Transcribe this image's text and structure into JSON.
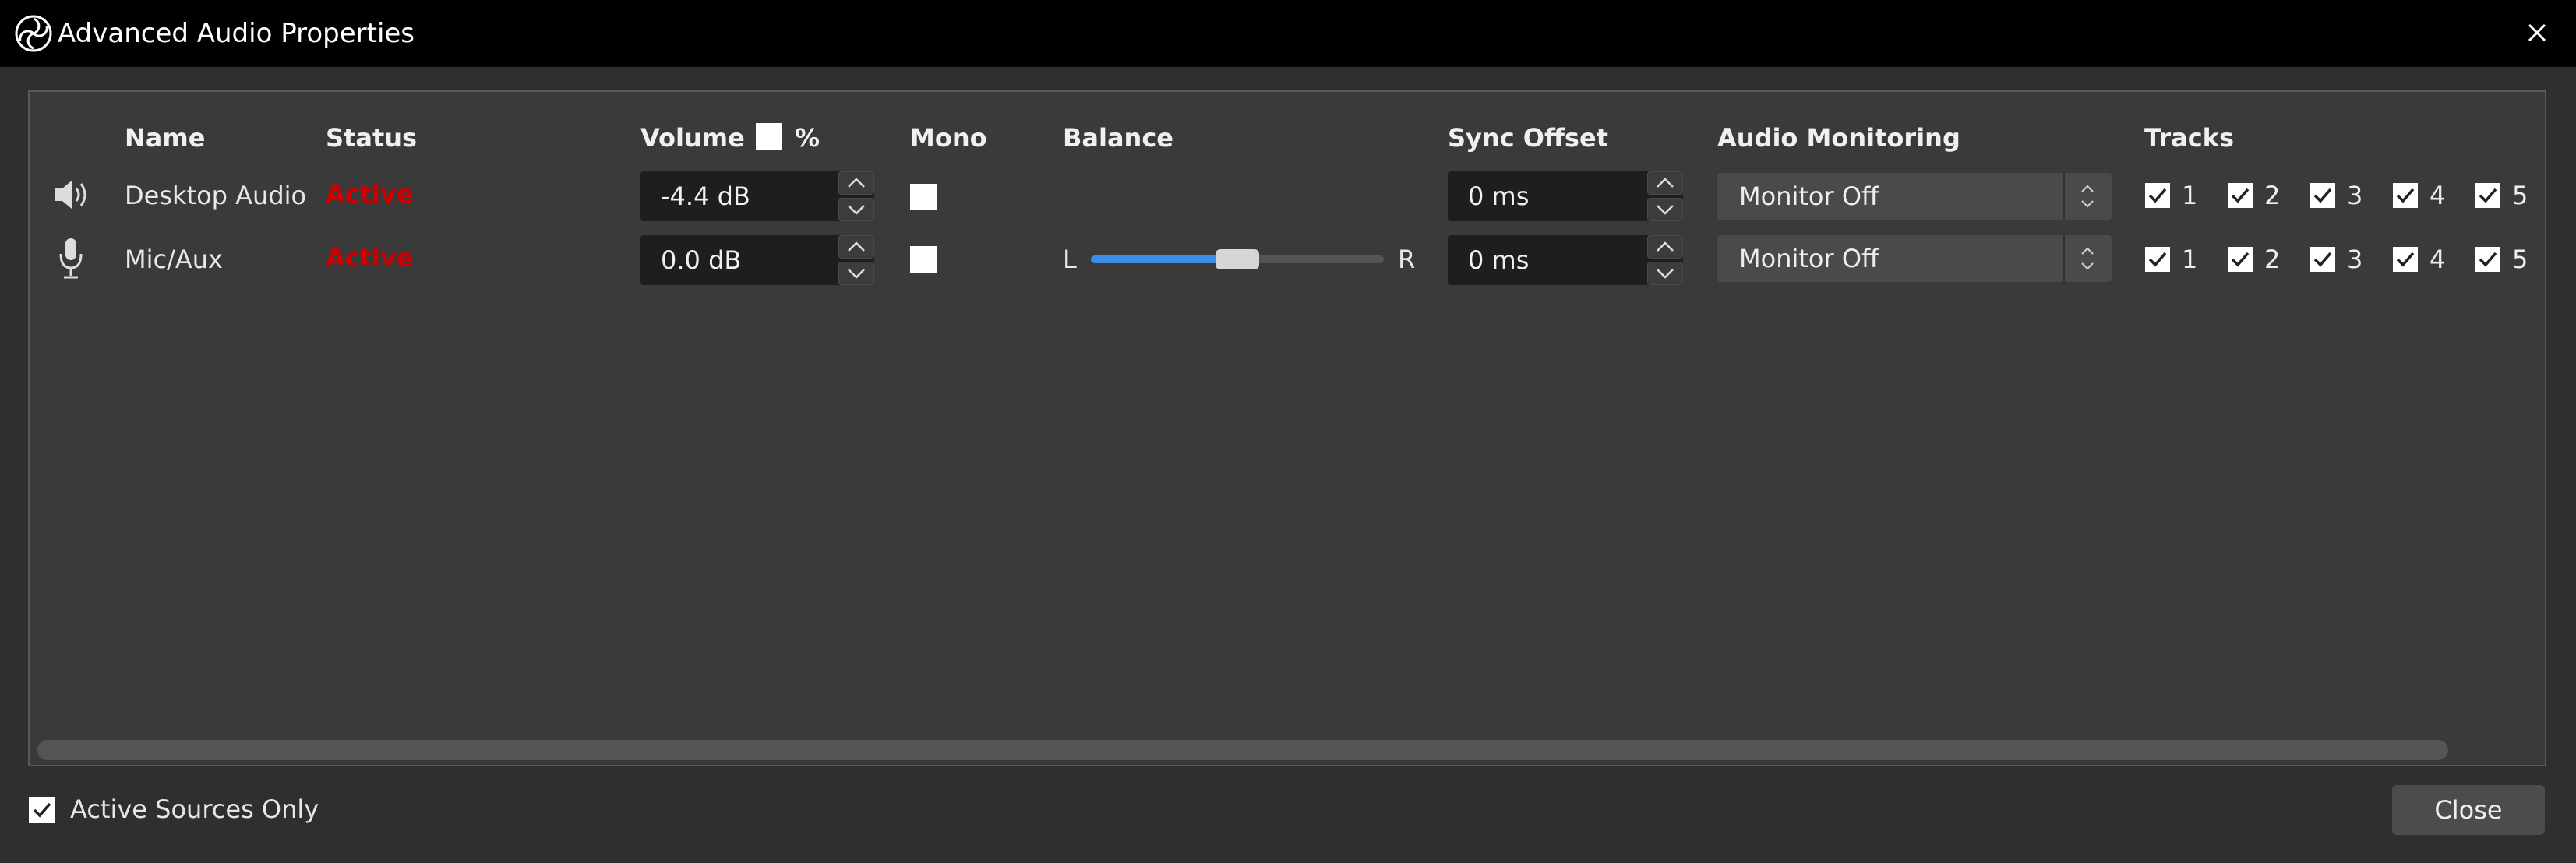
{
  "window": {
    "title": "Advanced Audio Properties"
  },
  "columns": {
    "name": "Name",
    "status": "Status",
    "volume": "Volume",
    "percent": "%",
    "mono": "Mono",
    "balance": "Balance",
    "sync_offset": "Sync Offset",
    "audio_monitoring": "Audio Monitoring",
    "tracks": "Tracks"
  },
  "rows": [
    {
      "icon": "speaker-icon",
      "name": "Desktop Audio",
      "status": "Active",
      "volume": "-4.4 dB",
      "mono": false,
      "sync_offset": "0 ms",
      "monitoring": "Monitor Off",
      "tracks": [
        "1",
        "2",
        "3",
        "4",
        "5"
      ]
    },
    {
      "icon": "microphone-icon",
      "name": "Mic/Aux",
      "status": "Active",
      "volume": "0.0 dB",
      "mono": false,
      "balance": {
        "left_label": "L",
        "right_label": "R",
        "value": 0.5
      },
      "sync_offset": "0 ms",
      "monitoring": "Monitor Off",
      "tracks": [
        "1",
        "2",
        "3",
        "4",
        "5"
      ]
    }
  ],
  "footer": {
    "active_sources_only": "Active Sources Only",
    "close": "Close"
  },
  "colors": {
    "status_active": "#cc0000",
    "slider_fill": "#3a8ee6"
  }
}
